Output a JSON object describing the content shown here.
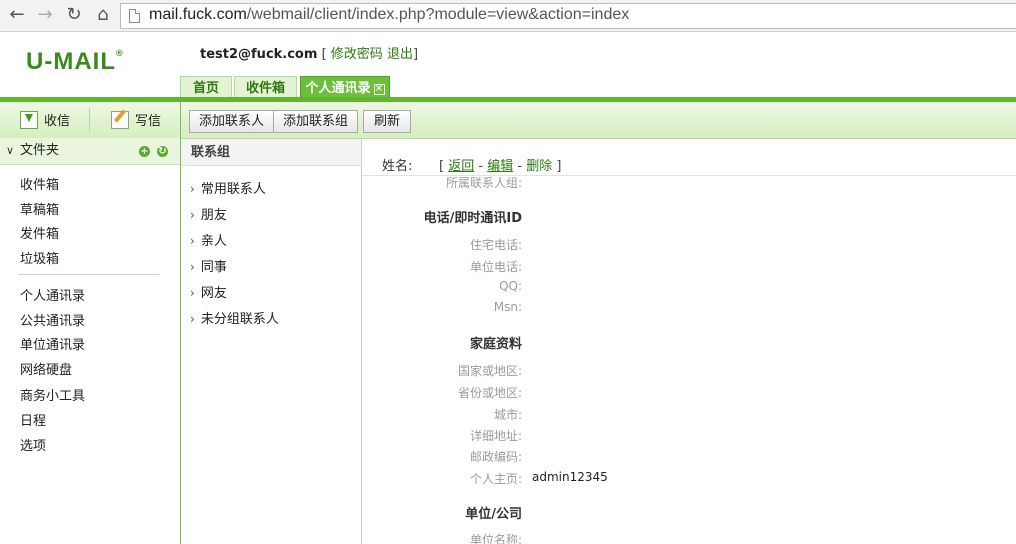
{
  "browser": {
    "url_host": "mail.fuck.com",
    "url_path": "/webmail/client/index.php?module=view&action=index"
  },
  "header": {
    "logo": "U-MAIL",
    "logo_mark": "®",
    "user": "test2@fuck.com",
    "bracket_open": "[",
    "change_password": "修改密码",
    "logout": "退出",
    "bracket_close": "]",
    "tabs": [
      {
        "label": "首页"
      },
      {
        "label": "收件箱"
      },
      {
        "label": "个人通讯录",
        "active": true,
        "close": "×"
      }
    ]
  },
  "left": {
    "receive": "收信",
    "compose": "写信",
    "folder_header": "文件夹",
    "add_folder": "+",
    "refresh_folder": "↻",
    "folders": [
      "收件箱",
      "草稿箱",
      "发件箱",
      "垃圾箱"
    ],
    "modules": [
      "个人通讯录",
      "公共通讯录",
      "单位通讯录",
      "网络硬盘",
      "商务小工具",
      "日程",
      "选项"
    ]
  },
  "toolbar": {
    "add_contact": "添加联系人",
    "add_group": "添加联系组",
    "refresh": "刷新"
  },
  "groups": {
    "header": "联系组",
    "items": [
      "常用联系人",
      "朋友",
      "亲人",
      "同事",
      "网友",
      "未分组联系人"
    ]
  },
  "detail": {
    "name_label": "姓名:",
    "actions": {
      "open": "[",
      "back": "返回",
      "edit": "编辑",
      "delete": "删除",
      "dash": "-",
      "close": "]"
    },
    "group_label": "所属联系人组:",
    "section_phone": "电话/即时通讯ID",
    "home_phone": "住宅电话:",
    "work_phone": "单位电话:",
    "qq": "QQ:",
    "msn": "Msn:",
    "section_home": "家庭资料",
    "country": "国家或地区:",
    "province": "省份或地区:",
    "city": "城市:",
    "address": "详细地址:",
    "postcode": "邮政编码:",
    "homepage": "个人主页:",
    "homepage_value": "admin12345",
    "section_company": "单位/公司",
    "company_name": "单位名称:"
  },
  "colors": {
    "brand_green": "#3a8b1e",
    "accent_green": "#62b52e",
    "link_green": "#2a7a10"
  }
}
